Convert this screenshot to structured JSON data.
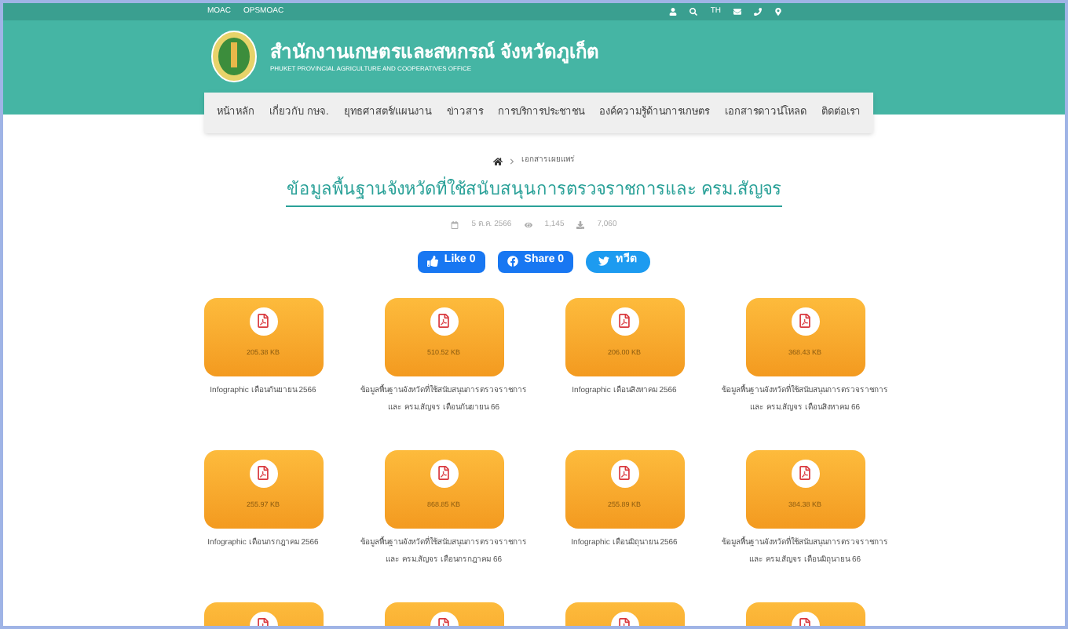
{
  "top_bar": {
    "links": [
      "MOAC",
      "OPSMOAC"
    ],
    "language": "TH"
  },
  "header": {
    "title": "สำนักงานเกษตรและสหกรณ์ จังหวัดภูเก็ต",
    "subtitle": "PHUKET PROVINCIAL AGRICULTURE AND COOPERATIVES OFFICE"
  },
  "nav": [
    "หน้าหลัก",
    "เกี่ยวกับ กษจ.",
    "ยุทธศาสตร์/แผนงาน",
    "ข่าวสาร",
    "การบริการประชาชน",
    "องค์ความรู้ด้านการเกษตร",
    "เอกสารดาวน์โหลด",
    "ติดต่อเรา"
  ],
  "breadcrumb": "เอกสารเผยแพร่",
  "title": "ข้อมูลพื้นฐานจังหวัดที่ใช้สนับสนุนการตรวจราชการและ ครม.สัญจร",
  "meta": {
    "date": "5 ต.ค. 2566",
    "views": "1,145",
    "downloads": "7,060"
  },
  "share": [
    {
      "kind": "like",
      "label": "Like 0"
    },
    {
      "kind": "share",
      "label": "Share 0"
    },
    {
      "kind": "tweet",
      "label": "ทวีต"
    }
  ],
  "files": [
    {
      "kind": "file",
      "size": "205.38 KB",
      "caption": "Infographic เดือนกันยายน 2566"
    },
    {
      "kind": "file",
      "size": "510.52 KB",
      "caption": "ข้อมูลพื้นฐานจังหวัดที่ใช้สนับสนุนการตรวจราชการ และ ครม.สัญจร เดือนกันยายน 66"
    },
    {
      "kind": "file",
      "size": "206.00 KB",
      "caption": "Infographic เดือนสิงหาคม 2566"
    },
    {
      "kind": "file",
      "size": "368.43 KB",
      "caption": "ข้อมูลพื้นฐานจังหวัดที่ใช้สนับสนุนการตรวจราชการ และ ครม.สัญจร เดือนสิงหาคม 66"
    },
    {
      "kind": "file",
      "size": "255.97 KB",
      "caption": "Infographic เดือนกรกฎาคม 2566"
    },
    {
      "kind": "file",
      "size": "868.85 KB",
      "caption": "ข้อมูลพื้นฐานจังหวัดที่ใช้สนับสนุนการตรวจราชการ และ ครม.สัญจร เดือนกรกฎาคม 66"
    },
    {
      "kind": "file",
      "size": "255.89 KB",
      "caption": "Infographic เดือนมิถุนายน 2566"
    },
    {
      "kind": "file",
      "size": "384.38 KB",
      "caption": "ข้อมูลพื้นฐานจังหวัดที่ใช้สนับสนุนการตรวจราชการ และ ครม.สัญจร เดือนมิถุนายน 66"
    },
    {
      "kind": "cut"
    },
    {
      "kind": "cut"
    },
    {
      "kind": "cut"
    },
    {
      "kind": "cut"
    }
  ]
}
